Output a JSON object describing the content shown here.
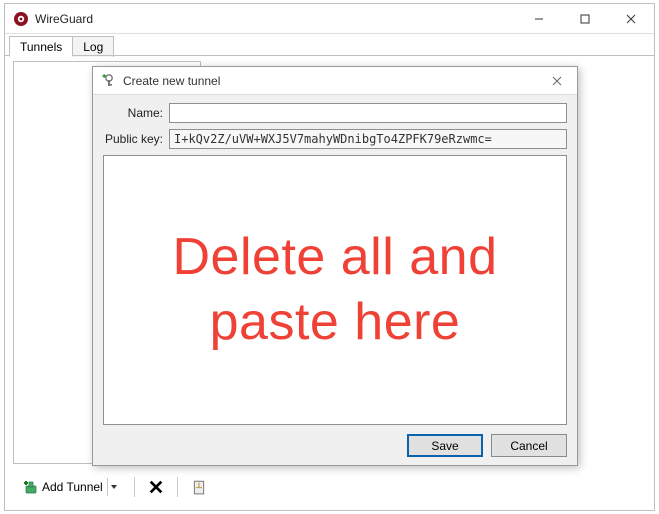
{
  "app": {
    "title": "WireGuard"
  },
  "tabs": {
    "tunnels": "Tunnels",
    "log": "Log"
  },
  "toolbar": {
    "add_tunnel": "Add Tunnel"
  },
  "dialog": {
    "title": "Create new tunnel",
    "name_label": "Name:",
    "name_value": "",
    "pubkey_label": "Public key:",
    "pubkey_value": "I+kQv2Z/uVW+WXJ5V7mahyWDnibgTo4ZPFK79eRzwmc=",
    "overlay_line1": "Delete all and",
    "overlay_line2": "paste here",
    "save": "Save",
    "cancel": "Cancel"
  }
}
